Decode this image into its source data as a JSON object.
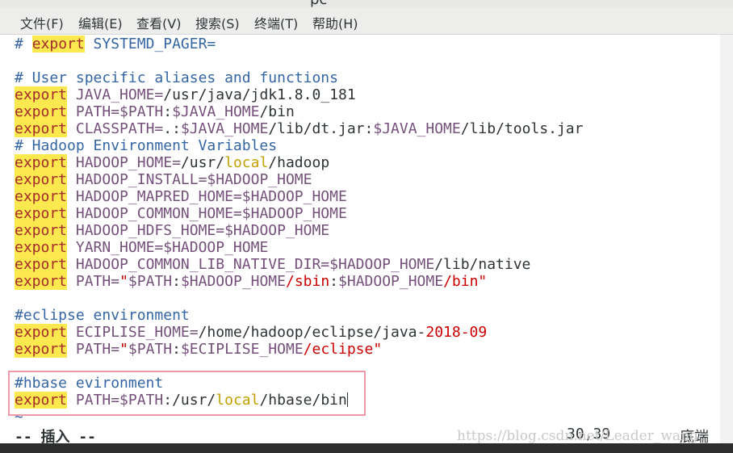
{
  "window": {
    "title_fragment": "pc"
  },
  "menu": [
    "文件(F)",
    "编辑(E)",
    "查看(V)",
    "搜索(S)",
    "终端(T)",
    "帮助(H)"
  ],
  "editor": {
    "lines": [
      {
        "tokens": [
          {
            "t": "# ",
            "c": "comment"
          },
          {
            "t": "export",
            "c": "export-c"
          },
          {
            "t": " SYSTEMD_PAGER=",
            "c": "comment"
          }
        ]
      },
      {
        "tokens": []
      },
      {
        "tokens": [
          {
            "t": "# User specific aliases and functions",
            "c": "comment"
          }
        ]
      },
      {
        "tokens": [
          {
            "t": "export",
            "c": "export"
          },
          {
            "t": " JAVA_HOME=",
            "c": "var"
          },
          {
            "t": "/usr/java/jdk1.8.0_181",
            "c": "path"
          }
        ]
      },
      {
        "tokens": [
          {
            "t": "export",
            "c": "export"
          },
          {
            "t": " PATH=$PATH",
            "c": "var"
          },
          {
            "t": ":",
            "c": "punct"
          },
          {
            "t": "$JAVA_HOME",
            "c": "var"
          },
          {
            "t": "/bin",
            "c": "path"
          }
        ]
      },
      {
        "tokens": [
          {
            "t": "export",
            "c": "export"
          },
          {
            "t": " CLASSPATH=",
            "c": "var"
          },
          {
            "t": ".:",
            "c": "punct"
          },
          {
            "t": "$JAVA_HOME",
            "c": "var"
          },
          {
            "t": "/lib/dt.jar:",
            "c": "path"
          },
          {
            "t": "$JAVA_HOME",
            "c": "var"
          },
          {
            "t": "/lib/tools.jar",
            "c": "path"
          }
        ]
      },
      {
        "tokens": [
          {
            "t": "# Hadoop Environment Variables",
            "c": "comment"
          }
        ]
      },
      {
        "tokens": [
          {
            "t": "export",
            "c": "export"
          },
          {
            "t": " HADOOP_HOME=",
            "c": "var"
          },
          {
            "t": "/usr/",
            "c": "path"
          },
          {
            "t": "local",
            "c": "local"
          },
          {
            "t": "/hadoop",
            "c": "path"
          }
        ]
      },
      {
        "tokens": [
          {
            "t": "export",
            "c": "export"
          },
          {
            "t": " HADOOP_INSTALL=$HADOOP_HOME",
            "c": "var"
          }
        ]
      },
      {
        "tokens": [
          {
            "t": "export",
            "c": "export"
          },
          {
            "t": " HADOOP_MAPRED_HOME=$HADOOP_HOME",
            "c": "var"
          }
        ]
      },
      {
        "tokens": [
          {
            "t": "export",
            "c": "export"
          },
          {
            "t": " HADOOP_COMMON_HOME=$HADOOP_HOME",
            "c": "var"
          }
        ]
      },
      {
        "tokens": [
          {
            "t": "export",
            "c": "export"
          },
          {
            "t": " HADOOP_HDFS_HOME=$HADOOP_HOME",
            "c": "var"
          }
        ]
      },
      {
        "tokens": [
          {
            "t": "export",
            "c": "export"
          },
          {
            "t": " YARN_HOME=$HADOOP_HOME",
            "c": "var"
          }
        ]
      },
      {
        "tokens": [
          {
            "t": "export",
            "c": "export"
          },
          {
            "t": " HADOOP_COMMON_LIB_NATIVE_DIR=$HADOOP_HOME",
            "c": "var"
          },
          {
            "t": "/lib/native",
            "c": "path"
          }
        ]
      },
      {
        "tokens": [
          {
            "t": "export",
            "c": "export"
          },
          {
            "t": " PATH=",
            "c": "var"
          },
          {
            "t": "\"",
            "c": "red"
          },
          {
            "t": "$PATH",
            "c": "var"
          },
          {
            "t": ":",
            "c": "punct"
          },
          {
            "t": "$HADOOP_HOME",
            "c": "var"
          },
          {
            "t": "/sbin",
            "c": "red"
          },
          {
            "t": ":",
            "c": "punct"
          },
          {
            "t": "$HADOOP_HOME",
            "c": "var"
          },
          {
            "t": "/bin\"",
            "c": "red"
          }
        ]
      },
      {
        "tokens": []
      },
      {
        "tokens": [
          {
            "t": "#eclipse environment",
            "c": "comment"
          }
        ]
      },
      {
        "tokens": [
          {
            "t": "export",
            "c": "export"
          },
          {
            "t": " ECIPLISE_HOME=",
            "c": "var"
          },
          {
            "t": "/home/hadoop/eclipse/java-",
            "c": "path"
          },
          {
            "t": "2018-09",
            "c": "red"
          }
        ]
      },
      {
        "tokens": [
          {
            "t": "export",
            "c": "export"
          },
          {
            "t": " PATH=",
            "c": "var"
          },
          {
            "t": "\"",
            "c": "red"
          },
          {
            "t": "$PATH",
            "c": "var"
          },
          {
            "t": ":",
            "c": "punct"
          },
          {
            "t": "$ECIPLISE_HOME",
            "c": "var"
          },
          {
            "t": "/eclipse\"",
            "c": "red"
          }
        ]
      },
      {
        "tokens": []
      },
      {
        "tokens": [
          {
            "t": "#hbase evironment",
            "c": "comment"
          }
        ]
      },
      {
        "tokens": [
          {
            "t": "export",
            "c": "export"
          },
          {
            "t": " PATH=$PATH",
            "c": "var"
          },
          {
            "t": ":/usr/",
            "c": "path"
          },
          {
            "t": "local",
            "c": "local"
          },
          {
            "t": "/hbase/bin",
            "c": "path"
          },
          {
            "t": "",
            "c": "cursor"
          }
        ]
      },
      {
        "tokens": [
          {
            "t": "~",
            "c": "tilde"
          }
        ]
      }
    ]
  },
  "status": {
    "mode": "-- 插入 --",
    "position": "30,39",
    "scroll": "底端"
  },
  "watermark": "https://blog.csdn.net/Leader_wang",
  "colors": {
    "export_bg": "#fce94f",
    "comment": "#3465a4",
    "variable": "#75507b",
    "string_red": "#cc0000",
    "local_keyword": "#c4a000",
    "highlight_border": "#f09aa8"
  }
}
